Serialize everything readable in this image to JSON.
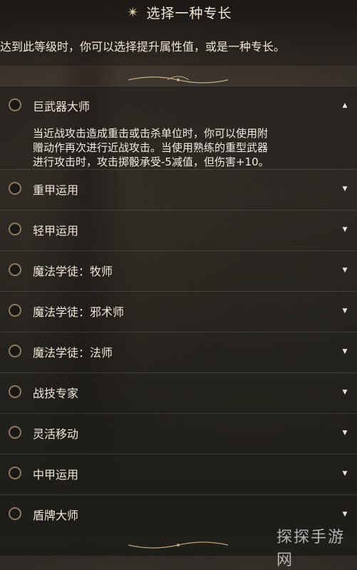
{
  "header": {
    "title": "选择一种专长",
    "subtitle": "达到此等级时，你可以选择提升属性值，或是一种专长。"
  },
  "feats": [
    {
      "label": "巨武器大师",
      "expanded": true,
      "description_line1": "当近战攻击造成重击或击杀单位时，你可以使用附",
      "description_line2": "赠动作再次进行近战攻击。当使用熟练的重型武器",
      "description_line3": "进行攻击时，攻击掷骰承受-5减值，但伤害+10。"
    },
    {
      "label": "重甲运用",
      "expanded": false
    },
    {
      "label": "轻甲运用",
      "expanded": false
    },
    {
      "label": "魔法学徒：牧师",
      "expanded": false
    },
    {
      "label": "魔法学徒：邪术师",
      "expanded": false
    },
    {
      "label": "魔法学徒：法师",
      "expanded": false
    },
    {
      "label": "战技专家",
      "expanded": false
    },
    {
      "label": "灵活移动",
      "expanded": false
    },
    {
      "label": "中甲运用",
      "expanded": false
    },
    {
      "label": "盾牌大师",
      "expanded": false
    }
  ],
  "icons": {
    "title_icon": "sparkle-star-icon",
    "collapse": "chevron-up-icon",
    "expand": "chevron-down-icon"
  },
  "watermark": "探探手游网"
}
